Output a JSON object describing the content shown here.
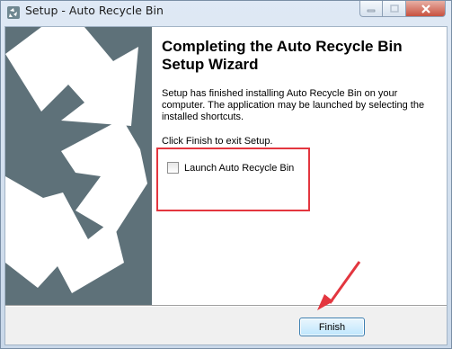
{
  "window": {
    "title": "Setup - Auto Recycle Bin"
  },
  "caption_buttons": {
    "minimize_icon": "minimize-icon",
    "maximize_icon": "maximize-icon",
    "close_icon": "close-icon"
  },
  "wizard": {
    "heading": "Completing the Auto Recycle Bin Setup Wizard",
    "description": "Setup has finished installing Auto Recycle Bin on your computer. The application may be launched by selecting the installed shortcuts.",
    "finish_note": "Click Finish to exit Setup.",
    "launch_checkbox": {
      "label": "Launch Auto Recycle Bin",
      "checked": false
    }
  },
  "footer": {
    "finish_label": "Finish"
  },
  "colors": {
    "side_panel": "#5e7179",
    "annotation_red": "#e3363f"
  }
}
